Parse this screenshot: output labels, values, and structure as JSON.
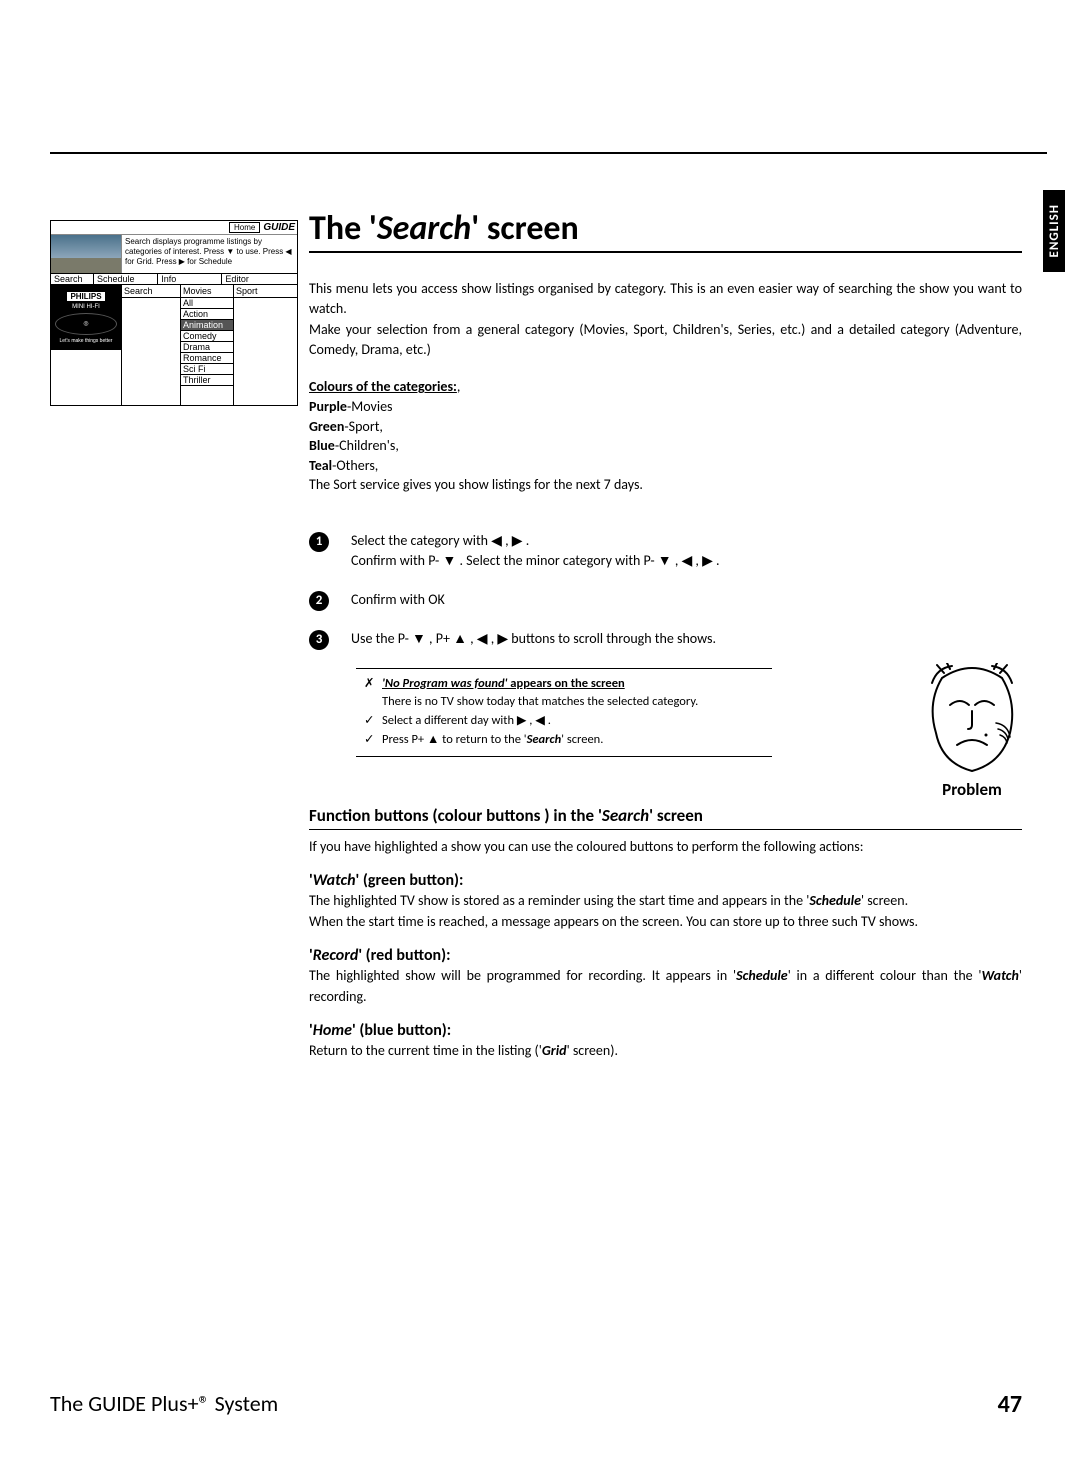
{
  "lang_tab": "ENGLISH",
  "osd": {
    "home": "Home",
    "guide_logo": "GUIDE",
    "desc": "Search displays programme listings by categories of interest. Press ▼ to use. Press ◀ for Grid. Press ▶ for Schedule",
    "tabs": [
      "Search",
      "Schedule",
      "Info",
      "Editor"
    ],
    "search_cell": "Search",
    "movies_hdr": "Movies",
    "movies_items": [
      "All",
      "Action",
      "Animation",
      "Comedy",
      "Drama",
      "Romance",
      "Sci Fi",
      "Thriller"
    ],
    "movies_selected_index": 2,
    "sport_hdr": "Sport",
    "ad_brand": "PHILIPS",
    "ad_line1": "MINI HI-FI",
    "ad_line2": "Let's make things better"
  },
  "title_pre": "The '",
  "title_em": "Search",
  "title_post": "' screen",
  "intro": {
    "p1": "This menu lets you access show listings organised by category. This is an even easier way of searching the show you want to watch.",
    "p2": "Make your selection from a general category (Movies, Sport, Children's, Series, etc.) and a detailed category (Adventure, Comedy, Drama, etc.)"
  },
  "categories": {
    "header": "Colours of the categories:",
    "lines": [
      {
        "b": "Purple",
        "t": "-Movies"
      },
      {
        "b": "Green",
        "t": "-Sport,"
      },
      {
        "b": "Blue",
        "t": "-Children's,"
      },
      {
        "b": "Teal",
        "t": "-Others,"
      }
    ],
    "sort_line": "The Sort service gives you show listings for the next 7 days."
  },
  "steps": {
    "s1a": "Select the category with  ◀ ,  ▶ .",
    "s1b": "Confirm  with   P- ▼  .  Select  the  minor  category  with   P- ▼  ,   ◀  , ▶ .",
    "s2": "Confirm with  OK",
    "s3": "Use the  P- ▼ ,  P+ ▲ ,  ◀ ,  ▶  buttons to scroll through the shows."
  },
  "problem": {
    "l1_mark": "✗",
    "l1_em": "'No Program was found'",
    "l1_rest": " appears on the screen",
    "l2": "There is no TV show today that matches the selected category.",
    "l3_mark": "✓",
    "l3": "Select a different day with  ▶ ,  ◀ .",
    "l4_mark": "✓",
    "l4_a": "Press  P+ ▲  to return to the '",
    "l4_em": "Search",
    "l4_b": "' screen.",
    "label": "Problem"
  },
  "fn_heading_pre": "Function buttons (colour buttons ) in the '",
  "fn_heading_em": "Search",
  "fn_heading_post": "' screen",
  "fn_intro": "If you have highlighted a show you can use the coloured buttons to perform the following actions:",
  "watch": {
    "title_q": "Watch",
    "title_rest": "' (green button):",
    "p1a": "The highlighted TV show is stored as a reminder using the start time and appears in the '",
    "p1em": "Schedule",
    "p1b": "' screen.",
    "p2": "When the start time is reached, a message appears on the screen. You can store up to three such TV shows."
  },
  "record": {
    "title_q": "Record",
    "title_rest": "' (red button):",
    "p1a": "The highlighted show will be programmed for recording. It appears in '",
    "p1em1": "Schedule",
    "p1b": "' in a different colour than the '",
    "p1em2": "Watch",
    "p1c": "' recording."
  },
  "home": {
    "title_q": "Home",
    "title_rest": "' (blue button):",
    "p1a": "Return to the current time in the listing ('",
    "p1em": "Grid",
    "p1b": "' screen)."
  },
  "footer_left": "The GUIDE Plus+® System",
  "footer_right": "47"
}
